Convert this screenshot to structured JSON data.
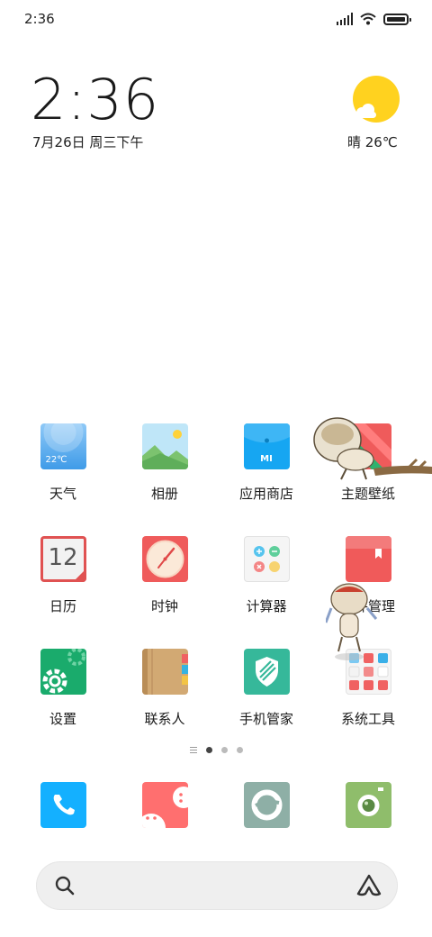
{
  "status_bar": {
    "time": "2:36"
  },
  "clock_widget": {
    "time": "2:36",
    "date": "7月26日 周三下午"
  },
  "weather_widget": {
    "condition_temp": "晴 26℃",
    "icon": "sun-cloud-icon"
  },
  "apps": [
    {
      "label": "天气",
      "icon": "weather-icon",
      "icon_text": "22℃"
    },
    {
      "label": "相册",
      "icon": "gallery-icon"
    },
    {
      "label": "应用商店",
      "icon": "app-store-icon",
      "icon_text": "MI"
    },
    {
      "label": "主题壁纸",
      "icon": "themes-icon"
    },
    {
      "label": "日历",
      "icon": "calendar-icon",
      "icon_text": "12"
    },
    {
      "label": "时钟",
      "icon": "clock-icon"
    },
    {
      "label": "计算器",
      "icon": "calculator-icon"
    },
    {
      "label": "文件管理",
      "icon": "file-manager-icon"
    },
    {
      "label": "设置",
      "icon": "settings-icon"
    },
    {
      "label": "联系人",
      "icon": "contacts-icon"
    },
    {
      "label": "手机管家",
      "icon": "security-icon"
    },
    {
      "label": "系统工具",
      "icon": "tools-folder-icon"
    }
  ],
  "page_indicator": {
    "pages": 3,
    "current": 1
  },
  "dock": [
    {
      "icon": "phone-icon"
    },
    {
      "icon": "messages-icon"
    },
    {
      "icon": "browser-icon"
    },
    {
      "icon": "camera-icon"
    }
  ],
  "search_bar": {
    "icon": "search-icon",
    "right_icon": "assistant-icon"
  },
  "colors": {
    "weather_blue": "#4ea7ef",
    "appstore_blue": "#16a6f2",
    "theme_red": "#ef5b5b",
    "theme_green": "#2fb26e",
    "settings_green": "#1aab6c",
    "security_teal": "#36b89a",
    "phone_blue": "#14b0ff",
    "messages_pink": "#ff6f6f",
    "browser_gray": "#8eafa6",
    "camera_green": "#8fbd6b"
  }
}
